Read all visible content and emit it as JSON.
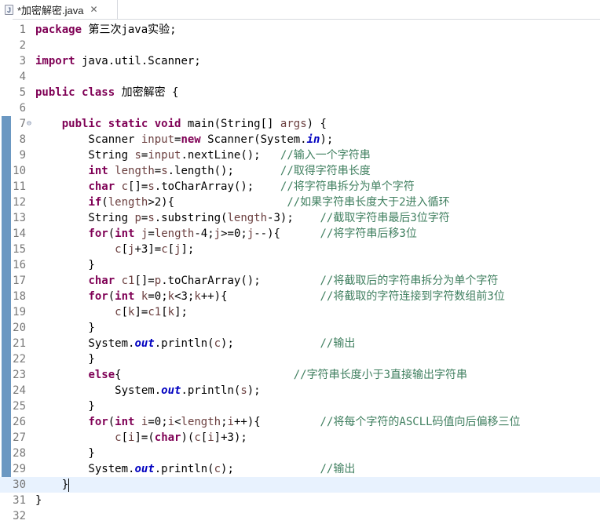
{
  "editor": {
    "tab": {
      "title": "*加密解密.java",
      "close": "✕",
      "file_type": "java"
    },
    "current_line": 30,
    "changed_lines": [
      7,
      8,
      9,
      10,
      11,
      12,
      13,
      14,
      15,
      16,
      17,
      18,
      19,
      20,
      21,
      22,
      23,
      24,
      25,
      26,
      27,
      28,
      29,
      30
    ],
    "fold_marker_line": 7,
    "lines": [
      [
        [
          "t",
          "package"
        ],
        [
          "p",
          " 第三次java实验;"
        ]
      ],
      [],
      [
        [
          "t",
          "import"
        ],
        [
          "p",
          " java.util.Scanner;"
        ]
      ],
      [],
      [
        [
          "t",
          "public"
        ],
        [
          "p",
          " "
        ],
        [
          "t",
          "class"
        ],
        [
          "p",
          " 加密解密 {"
        ]
      ],
      [],
      [
        [
          "p",
          "    "
        ],
        [
          "t",
          "public"
        ],
        [
          "p",
          " "
        ],
        [
          "t",
          "static"
        ],
        [
          "p",
          " "
        ],
        [
          "t",
          "void"
        ],
        [
          "p",
          " main(String[] "
        ],
        [
          "v",
          "args"
        ],
        [
          "p",
          ") {"
        ]
      ],
      [
        [
          "p",
          "        Scanner "
        ],
        [
          "v",
          "input"
        ],
        [
          "p",
          "="
        ],
        [
          "t",
          "new"
        ],
        [
          "p",
          " Scanner(System."
        ],
        [
          "f",
          "in"
        ],
        [
          "p",
          ");"
        ]
      ],
      [
        [
          "p",
          "        String "
        ],
        [
          "v",
          "s"
        ],
        [
          "p",
          "="
        ],
        [
          "v",
          "input"
        ],
        [
          "p",
          ".nextLine();   "
        ],
        [
          "c",
          "//输入一个字符串"
        ]
      ],
      [
        [
          "p",
          "        "
        ],
        [
          "t",
          "int"
        ],
        [
          "p",
          " "
        ],
        [
          "v",
          "length"
        ],
        [
          "p",
          "="
        ],
        [
          "v",
          "s"
        ],
        [
          "p",
          ".length();       "
        ],
        [
          "c",
          "//取得字符串长度"
        ]
      ],
      [
        [
          "p",
          "        "
        ],
        [
          "t",
          "char"
        ],
        [
          "p",
          " "
        ],
        [
          "v",
          "c"
        ],
        [
          "p",
          "[]="
        ],
        [
          "v",
          "s"
        ],
        [
          "p",
          ".toCharArray();    "
        ],
        [
          "c",
          "//将字符串拆分为单个字符"
        ]
      ],
      [
        [
          "p",
          "        "
        ],
        [
          "t",
          "if"
        ],
        [
          "p",
          "("
        ],
        [
          "v",
          "length"
        ],
        [
          "p",
          ">2){                 "
        ],
        [
          "c",
          "//如果字符串长度大于2进入循环"
        ]
      ],
      [
        [
          "p",
          "        String "
        ],
        [
          "v",
          "p"
        ],
        [
          "p",
          "="
        ],
        [
          "v",
          "s"
        ],
        [
          "p",
          ".substring("
        ],
        [
          "v",
          "length"
        ],
        [
          "p",
          "-3);    "
        ],
        [
          "c",
          "//截取字符串最后3位字符"
        ]
      ],
      [
        [
          "p",
          "        "
        ],
        [
          "t",
          "for"
        ],
        [
          "p",
          "("
        ],
        [
          "t",
          "int"
        ],
        [
          "p",
          " "
        ],
        [
          "v",
          "j"
        ],
        [
          "p",
          "="
        ],
        [
          "v",
          "length"
        ],
        [
          "p",
          "-4;"
        ],
        [
          "v",
          "j"
        ],
        [
          "p",
          ">=0;"
        ],
        [
          "v",
          "j"
        ],
        [
          "p",
          "--){      "
        ],
        [
          "c",
          "//将字符串后移3位"
        ]
      ],
      [
        [
          "p",
          "            "
        ],
        [
          "v",
          "c"
        ],
        [
          "p",
          "["
        ],
        [
          "v",
          "j"
        ],
        [
          "p",
          "+3]="
        ],
        [
          "v",
          "c"
        ],
        [
          "p",
          "["
        ],
        [
          "v",
          "j"
        ],
        [
          "p",
          "];"
        ]
      ],
      [
        [
          "p",
          "        }"
        ]
      ],
      [
        [
          "p",
          "        "
        ],
        [
          "t",
          "char"
        ],
        [
          "p",
          " "
        ],
        [
          "v",
          "c1"
        ],
        [
          "p",
          "[]="
        ],
        [
          "v",
          "p"
        ],
        [
          "p",
          ".toCharArray();         "
        ],
        [
          "c",
          "//将截取后的字符串拆分为单个字符"
        ]
      ],
      [
        [
          "p",
          "        "
        ],
        [
          "t",
          "for"
        ],
        [
          "p",
          "("
        ],
        [
          "t",
          "int"
        ],
        [
          "p",
          " "
        ],
        [
          "v",
          "k"
        ],
        [
          "p",
          "=0;"
        ],
        [
          "v",
          "k"
        ],
        [
          "p",
          "<3;"
        ],
        [
          "v",
          "k"
        ],
        [
          "p",
          "++){              "
        ],
        [
          "c",
          "//将截取的字符连接到字符数组前3位"
        ]
      ],
      [
        [
          "p",
          "            "
        ],
        [
          "v",
          "c"
        ],
        [
          "p",
          "["
        ],
        [
          "v",
          "k"
        ],
        [
          "p",
          "]="
        ],
        [
          "v",
          "c1"
        ],
        [
          "p",
          "["
        ],
        [
          "v",
          "k"
        ],
        [
          "p",
          "];"
        ]
      ],
      [
        [
          "p",
          "        }"
        ]
      ],
      [
        [
          "p",
          "        System."
        ],
        [
          "f",
          "out"
        ],
        [
          "p",
          ".println("
        ],
        [
          "v",
          "c"
        ],
        [
          "p",
          ");             "
        ],
        [
          "c",
          "//输出"
        ]
      ],
      [
        [
          "p",
          "        }"
        ]
      ],
      [
        [
          "p",
          "        "
        ],
        [
          "t",
          "else"
        ],
        [
          "p",
          "{                          "
        ],
        [
          "c",
          "//字符串长度小于3直接输出字符串"
        ]
      ],
      [
        [
          "p",
          "            System."
        ],
        [
          "f",
          "out"
        ],
        [
          "p",
          ".println("
        ],
        [
          "v",
          "s"
        ],
        [
          "p",
          ");"
        ]
      ],
      [
        [
          "p",
          "        }"
        ]
      ],
      [
        [
          "p",
          "        "
        ],
        [
          "t",
          "for"
        ],
        [
          "p",
          "("
        ],
        [
          "t",
          "int"
        ],
        [
          "p",
          " "
        ],
        [
          "v",
          "i"
        ],
        [
          "p",
          "=0;"
        ],
        [
          "v",
          "i"
        ],
        [
          "p",
          "<"
        ],
        [
          "v",
          "length"
        ],
        [
          "p",
          ";"
        ],
        [
          "v",
          "i"
        ],
        [
          "p",
          "++){         "
        ],
        [
          "c",
          "//将每个字符的ASCLL码值向后偏移三位"
        ]
      ],
      [
        [
          "p",
          "            "
        ],
        [
          "v",
          "c"
        ],
        [
          "p",
          "["
        ],
        [
          "v",
          "i"
        ],
        [
          "p",
          "]=("
        ],
        [
          "t",
          "char"
        ],
        [
          "p",
          ")("
        ],
        [
          "v",
          "c"
        ],
        [
          "p",
          "["
        ],
        [
          "v",
          "i"
        ],
        [
          "p",
          "]+3);"
        ]
      ],
      [
        [
          "p",
          "        }"
        ]
      ],
      [
        [
          "p",
          "        System."
        ],
        [
          "f",
          "out"
        ],
        [
          "p",
          ".println("
        ],
        [
          "v",
          "c"
        ],
        [
          "p",
          ");             "
        ],
        [
          "c",
          "//输出"
        ]
      ],
      [
        [
          "p",
          "    }"
        ]
      ],
      [
        [
          "p",
          "}"
        ]
      ],
      []
    ]
  }
}
